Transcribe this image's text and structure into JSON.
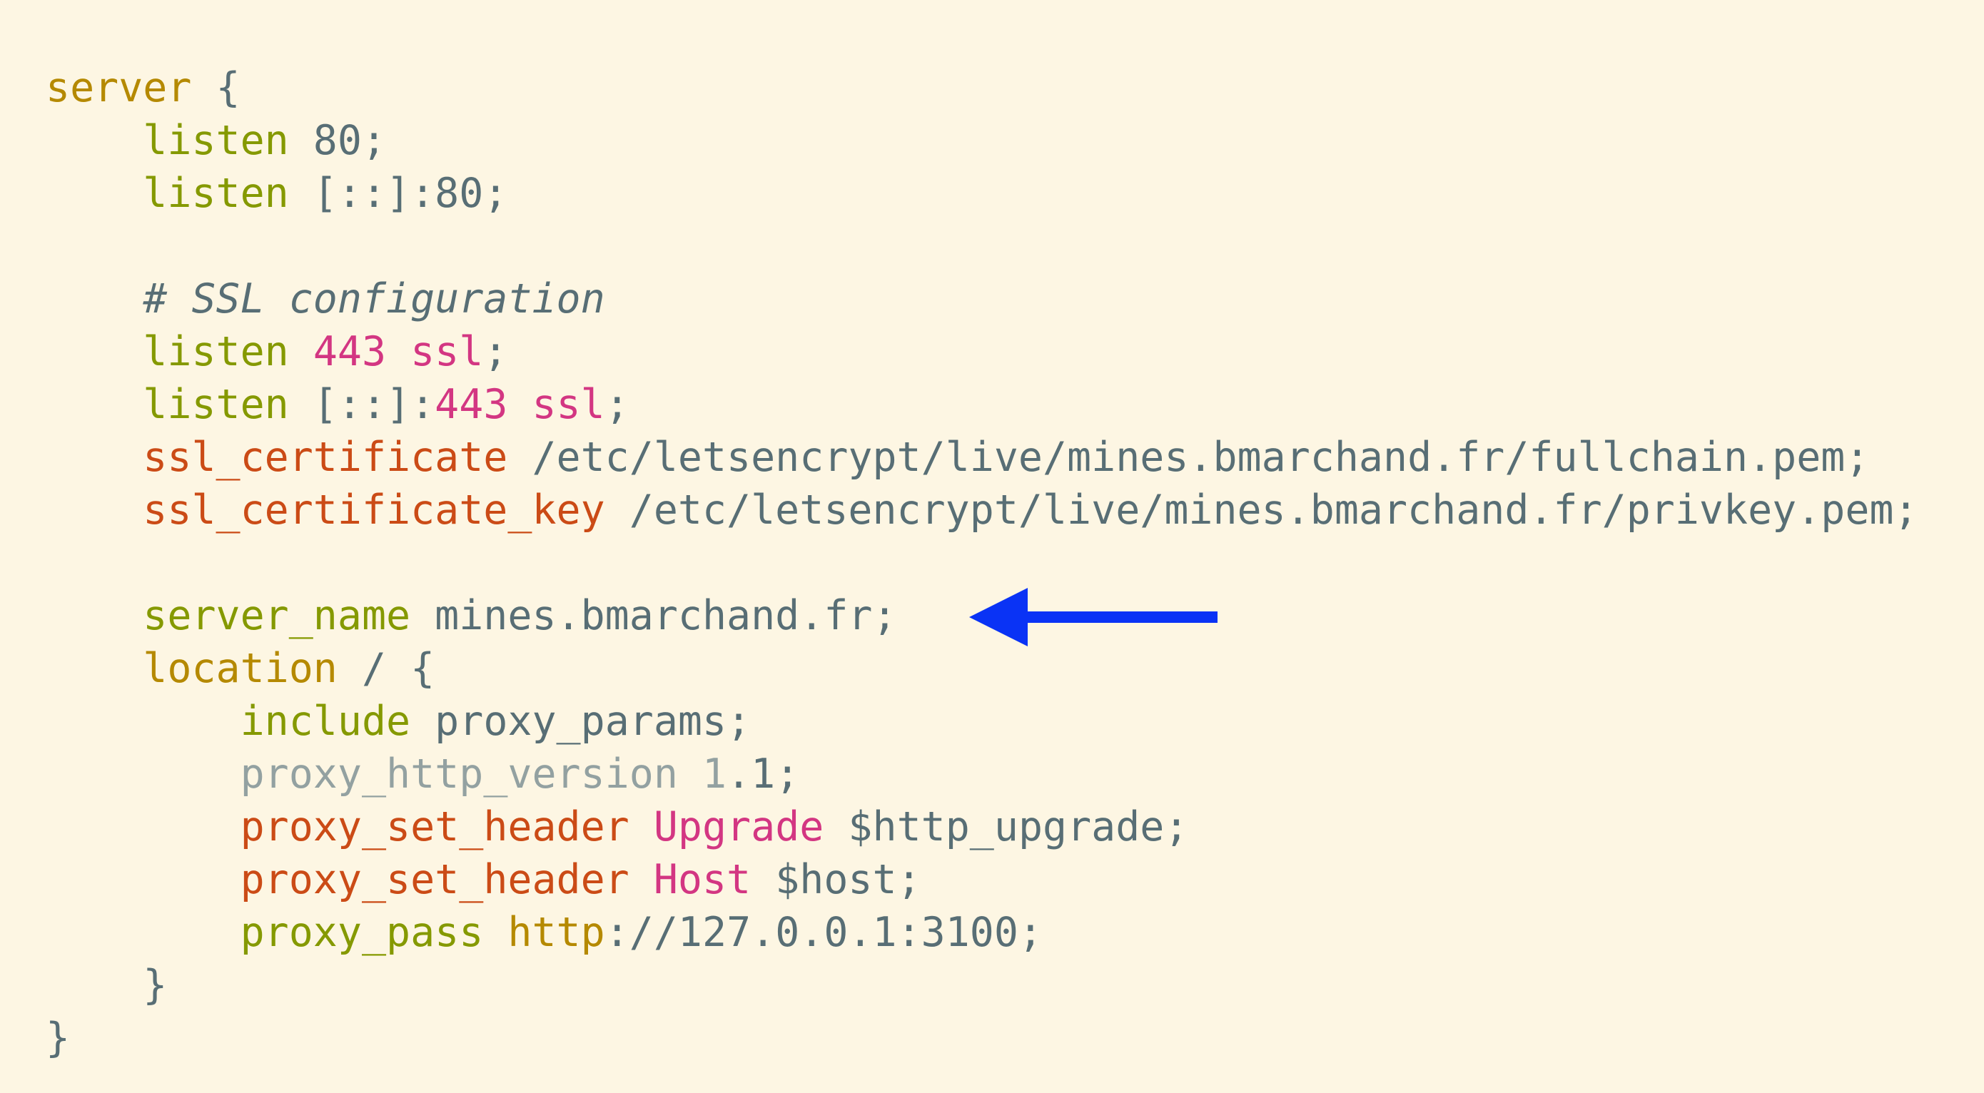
{
  "code_block": {
    "lines": [
      [
        {
          "t": "server",
          "c": "kw"
        },
        {
          "t": " {",
          "c": "txt"
        }
      ],
      [
        {
          "t": "    ",
          "c": "txt"
        },
        {
          "t": "listen",
          "c": "dir"
        },
        {
          "t": " 80;",
          "c": "txt"
        }
      ],
      [
        {
          "t": "    ",
          "c": "txt"
        },
        {
          "t": "listen",
          "c": "dir"
        },
        {
          "t": " [::]:80;",
          "c": "txt"
        }
      ],
      [],
      [
        {
          "t": "    ",
          "c": "txt"
        },
        {
          "t": "# SSL configuration",
          "c": "cmt"
        }
      ],
      [
        {
          "t": "    ",
          "c": "txt"
        },
        {
          "t": "listen",
          "c": "dir"
        },
        {
          "t": " ",
          "c": "txt"
        },
        {
          "t": "443 ssl",
          "c": "str"
        },
        {
          "t": ";",
          "c": "txt"
        }
      ],
      [
        {
          "t": "    ",
          "c": "txt"
        },
        {
          "t": "listen",
          "c": "dir"
        },
        {
          "t": " [::]:",
          "c": "txt"
        },
        {
          "t": "443 ssl",
          "c": "str"
        },
        {
          "t": ";",
          "c": "txt"
        }
      ],
      [
        {
          "t": "    ",
          "c": "txt"
        },
        {
          "t": "ssl_certificate",
          "c": "ssl"
        },
        {
          "t": " /etc/letsencrypt/live/mines.bmarchand.fr/fullchain.pem;",
          "c": "txt"
        }
      ],
      [
        {
          "t": "    ",
          "c": "txt"
        },
        {
          "t": "ssl_certificate_key",
          "c": "ssl"
        },
        {
          "t": " /etc/letsencrypt/live/mines.bmarchand.fr/privkey.pem;",
          "c": "txt"
        }
      ],
      [],
      [
        {
          "t": "    ",
          "c": "txt"
        },
        {
          "t": "server_name",
          "c": "dir"
        },
        {
          "t": " mines.bmarchand.fr;",
          "c": "txt"
        }
      ],
      [
        {
          "t": "    ",
          "c": "txt"
        },
        {
          "t": "location",
          "c": "kw"
        },
        {
          "t": " / {",
          "c": "txt"
        }
      ],
      [
        {
          "t": "        ",
          "c": "txt"
        },
        {
          "t": "include",
          "c": "dir"
        },
        {
          "t": " proxy_params;",
          "c": "txt"
        }
      ],
      [
        {
          "t": "        ",
          "c": "txt"
        },
        {
          "t": "proxy_http_version 1",
          "c": "dim"
        },
        {
          "t": ".1;",
          "c": "txt"
        }
      ],
      [
        {
          "t": "        ",
          "c": "txt"
        },
        {
          "t": "proxy_set_header",
          "c": "ssl"
        },
        {
          "t": " ",
          "c": "txt"
        },
        {
          "t": "Upgrade",
          "c": "str"
        },
        {
          "t": " $http_upgrade;",
          "c": "txt"
        }
      ],
      [
        {
          "t": "        ",
          "c": "txt"
        },
        {
          "t": "proxy_set_header",
          "c": "ssl"
        },
        {
          "t": " ",
          "c": "txt"
        },
        {
          "t": "Host",
          "c": "str"
        },
        {
          "t": " $host;",
          "c": "txt"
        }
      ],
      [
        {
          "t": "        ",
          "c": "txt"
        },
        {
          "t": "proxy_pass",
          "c": "dir"
        },
        {
          "t": " ",
          "c": "txt"
        },
        {
          "t": "http",
          "c": "kw"
        },
        {
          "t": "://127.0.0.1:3100;",
          "c": "txt"
        }
      ],
      [
        {
          "t": "    }",
          "c": "txt"
        }
      ],
      [
        {
          "t": "}",
          "c": "txt"
        }
      ]
    ]
  },
  "annotation": {
    "icon": "arrow-left-icon",
    "color": "#0a33f5",
    "points_to_line": 10
  },
  "colors": {
    "background": "#fdf6e3",
    "keyword": "#b58900",
    "directive": "#859900",
    "ssl_directive": "#cb4b16",
    "string": "#d33682",
    "text": "#586e75",
    "dim": "#93a1a1"
  }
}
